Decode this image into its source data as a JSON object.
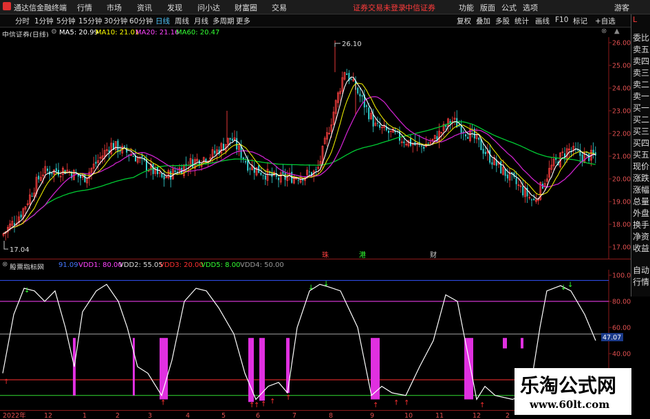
{
  "topbar": {
    "app_title": "通达信金融终端",
    "menu": [
      "行情",
      "市场",
      "资讯",
      "发现",
      "问小达",
      "财富圈",
      "交易"
    ],
    "notice": "证券交易未登录",
    "broker": "中信证券",
    "right_menu": [
      "功能",
      "版面",
      "公式",
      "选项"
    ],
    "guest": "游客"
  },
  "tabs": {
    "items": [
      "分时",
      "1分钟",
      "5分钟",
      "15分钟",
      "30分钟",
      "60分钟",
      "日线",
      "周线",
      "月线",
      "多周期",
      "更多"
    ],
    "active": "日线",
    "right_items": [
      "复权",
      "叠加",
      "多股",
      "统计",
      "画线",
      "F10",
      "标记",
      "+自选"
    ]
  },
  "main_legend": {
    "title": "中信证券(日线)",
    "ma5": "MA5: 20.99",
    "ma10": "MA10: 21.01",
    "ma20": "MA20: 21.16",
    "ma60": "MA60: 20.47"
  },
  "main_chart": {
    "price_ticks": [
      "26.00",
      "25.00",
      "24.00",
      "23.00",
      "22.00",
      "21.00",
      "20.00",
      "19.00",
      "18.00",
      "17.00"
    ],
    "high_label": "26.10",
    "low_label": "17.04",
    "markers": [
      "珠",
      "港",
      "财"
    ],
    "colors": {
      "ma5": "#ffffff",
      "ma10": "#ffff00",
      "ma20": "#ff00ff",
      "ma60": "#00ff00",
      "up": "#ff4040",
      "down": "#33d6d6"
    }
  },
  "sub_legend": {
    "title": "股票指标网",
    "v0": "91.09",
    "vdd1": "VDD1: 80.00",
    "vdd2": "VDD2: 55.05",
    "vdd3": "VDD3: 20.00",
    "vdd5": "VDD5: 8.00",
    "vdd4": "VDD4: 50.00"
  },
  "sub_chart": {
    "ticks": [
      "100.00",
      "80.00",
      "60.00",
      "40.00"
    ],
    "current_value": "47.07"
  },
  "right_panel": {
    "mode": "L",
    "items": [
      "委比",
      "卖五",
      "卖四",
      "卖三",
      "卖二",
      "卖一",
      "买一",
      "买二",
      "买三",
      "买四",
      "买五",
      "现价",
      "涨跌",
      "涨幅",
      "总量",
      "外盘",
      "换手",
      "净资",
      "收益"
    ],
    "bottom": [
      "自动",
      "行情"
    ]
  },
  "x_axis": {
    "labels": [
      "2022年",
      "12",
      "1",
      "2",
      "3",
      "4",
      "5",
      "6",
      "7",
      "8",
      "9",
      "10",
      "11",
      "12",
      "2"
    ]
  },
  "watermark": {
    "title": "乐淘公式网",
    "url": "www.60lt.com"
  }
}
